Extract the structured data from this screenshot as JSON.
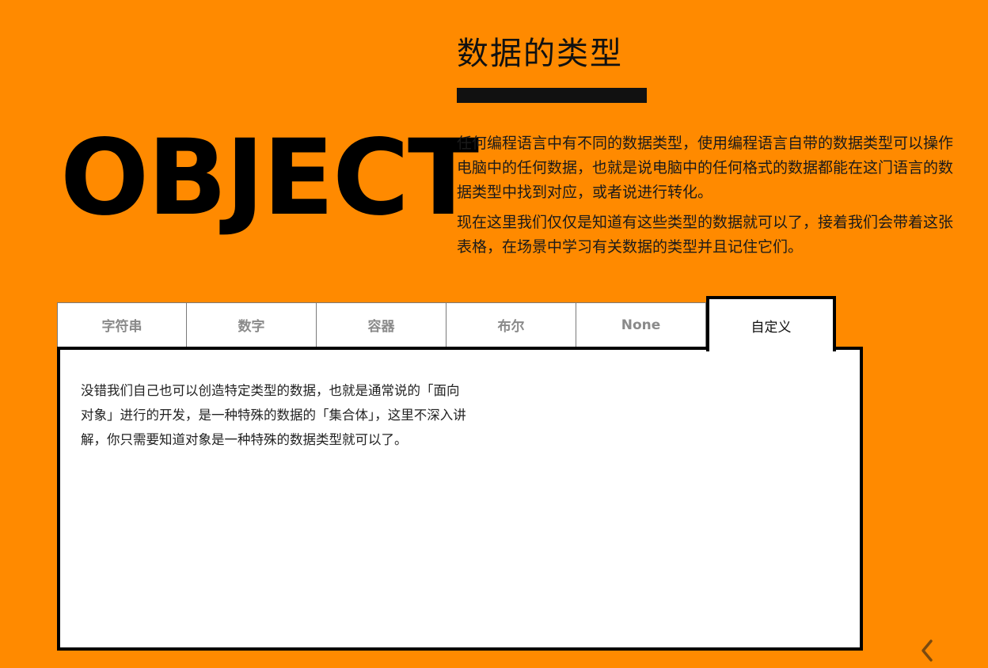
{
  "page": {
    "title": "数据的类型",
    "big_word": "OBJECT",
    "intro_paragraphs": [
      "任何编程语言中有不同的数据类型，使用编程语言自带的数据类型可以操作电脑中的任何数据，也就是说电脑中的任何格式的数据都能在这门语言的数据类型中找到对应，或者说进行转化。",
      "现在这里我们仅仅是知道有这些类型的数据就可以了，接着我们会带着这张表格，在场景中学习有关数据的类型并且记住它们。"
    ]
  },
  "tabs": [
    {
      "label": "字符串",
      "active": false
    },
    {
      "label": "数字",
      "active": false
    },
    {
      "label": "容器",
      "active": false
    },
    {
      "label": "布尔",
      "active": false
    },
    {
      "label": "None",
      "active": false
    },
    {
      "label": "自定义",
      "active": true
    }
  ],
  "panel": {
    "text": "没错我们自己也可以创造特定类型的数据，也就是通常说的「面向对象」进行的开发，是一种特殊的数据的「集合体」，这里不深入讲解，你只需要知道对象是一种特殊的数据类型就可以了。"
  },
  "nav": {
    "prev_icon": "chevron-left-icon"
  },
  "colors": {
    "background": "#ff8a00",
    "text": "#111111",
    "panel": "#ffffff",
    "inactive_tab_text": "#8a8a8a"
  }
}
